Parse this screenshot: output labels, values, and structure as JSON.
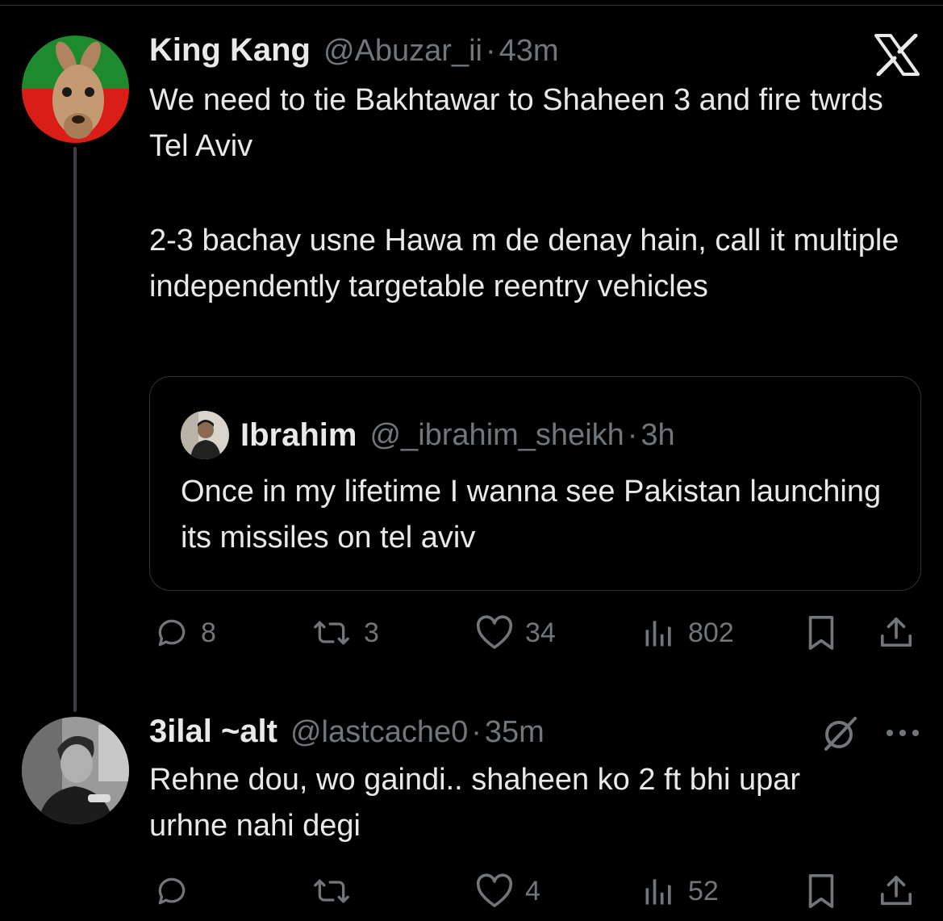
{
  "post": {
    "author_name": "King Kang",
    "author_handle": "@Abuzar_ii",
    "separator": "·",
    "time": "43m",
    "text_line1": "We need to tie Bakhtawar to Shaheen 3 and fire twrds Tel Aviv",
    "text_line2": "2-3 bachay usne Hawa m de denay hain, call it multiple independently targetable reentry vehicles",
    "avatar_icon": "kangaroo-avatar",
    "quote": {
      "author_name": "Ibrahim",
      "author_handle": "@_ibrahim_sheikh",
      "separator": "·",
      "time": "3h",
      "text": "Once in my lifetime I wanna see Pakistan launching its missiles on tel aviv"
    },
    "actions": {
      "replies": "8",
      "reposts": "3",
      "likes": "34",
      "views": "802"
    }
  },
  "reply": {
    "author_name": "3ilal ~alt",
    "author_handle": "@lastcache0",
    "separator": "·",
    "time": "35m",
    "text": "Rehne dou, wo gaindi.. shaheen ko 2 ft bhi upar urhne nahi degi",
    "avatar_icon": "man-avatar",
    "actions": {
      "replies": "",
      "reposts": "",
      "likes": "4",
      "views": "52"
    }
  },
  "icons": {
    "top_right": "x-logo-icon",
    "reply_menu": "more-icon",
    "grok": "grok-icon"
  },
  "colors": {
    "background": "#000000",
    "text": "#e7e9ea",
    "muted": "#71767b",
    "border": "#2f3336"
  }
}
